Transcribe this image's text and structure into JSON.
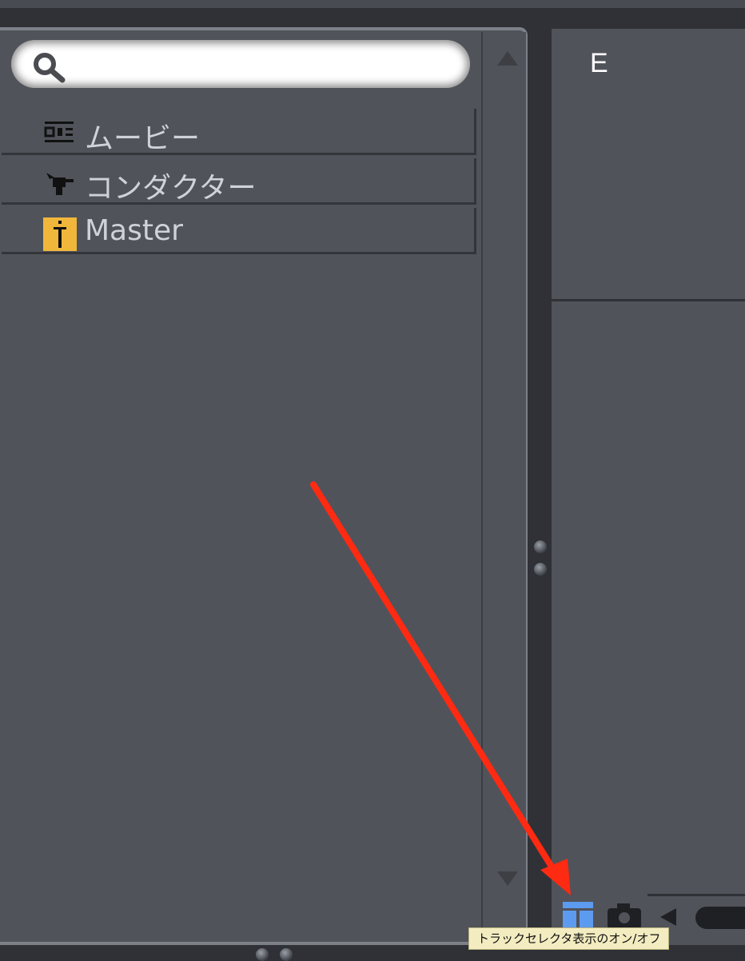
{
  "search": {
    "placeholder": "",
    "value": ""
  },
  "tracks": [
    {
      "label": "ムービー",
      "icon": "movie-track-icon",
      "highlight": false
    },
    {
      "label": "コンダクター",
      "icon": "conductor-track-icon",
      "highlight": false
    },
    {
      "label": "Master",
      "icon": "master-track-icon",
      "highlight": true,
      "highlight_color": "#f0b73b"
    }
  ],
  "right_panel": {
    "letter": "E"
  },
  "tooltip": {
    "text": "トラックセレクタ表示のオン/オフ"
  },
  "colors": {
    "annotation_arrow": "#ff2a12",
    "selector_button": "#5c9bf0"
  },
  "bottom_toolbar": {
    "buttons": [
      "track-selector-toggle-icon",
      "camera-icon",
      "play-left-icon"
    ]
  }
}
